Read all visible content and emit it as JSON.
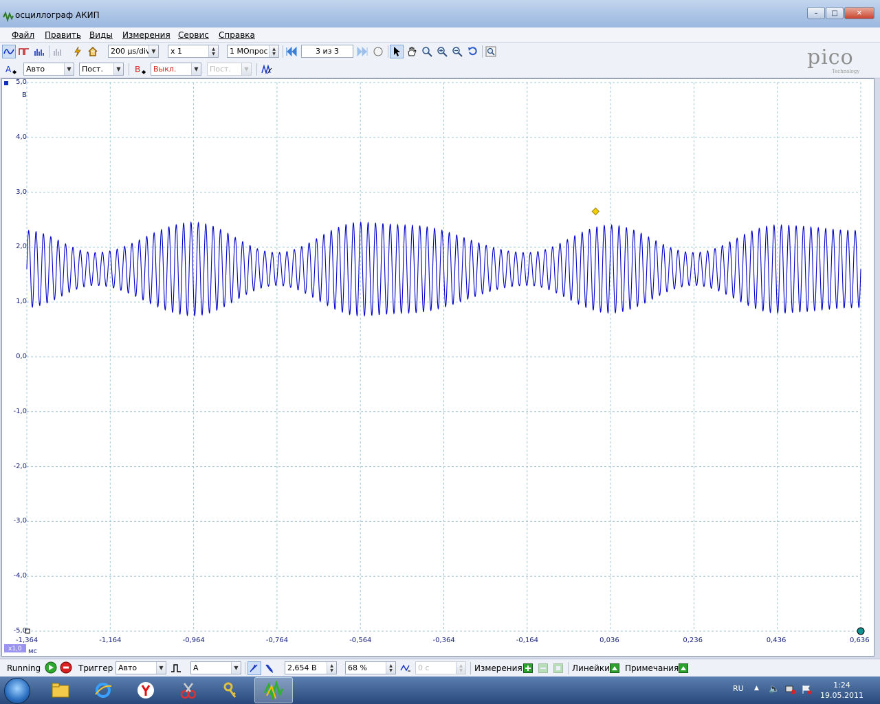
{
  "window": {
    "title": "осциллограф АКИП",
    "minimize": "–",
    "maximize": "□",
    "close": "✕"
  },
  "menu": [
    "Файл",
    "Править",
    "Виды",
    "Измерения",
    "Сервис",
    "Справка"
  ],
  "toolbar1": {
    "timebase": "200 µs/div",
    "zoom": "x 1",
    "samples": "1 МОпрос",
    "buffer": "3 из 3"
  },
  "toolbar2": {
    "chA_label": "A",
    "chA_range": "Авто",
    "chA_coupling": "Пост.",
    "chB_label": "B",
    "chB_range": "Выкл.",
    "chB_coupling": "Пост."
  },
  "logo": {
    "word": "pico",
    "sub": "Technology"
  },
  "plot": {
    "y_labels": [
      "5,0",
      "4,0",
      "3,0",
      "2,0",
      "1,0",
      "0,0",
      "-1,0",
      "-2,0",
      "-3,0",
      "-4,0",
      "-5,0"
    ],
    "y_unit": "В",
    "x_labels": [
      "-1,364",
      "-1,164",
      "-0,964",
      "-0,764",
      "-0,564",
      "-0,364",
      "-0,164",
      "0,036",
      "0,236",
      "0,436",
      "0,636"
    ],
    "x_unit": "мс",
    "zoom_badge": "x1,0",
    "trace_color": "#0000c8",
    "grid_color": "#9fc7d3"
  },
  "chart_data": {
    "type": "line",
    "xlabel": "мс",
    "ylabel": "В",
    "xlim": [
      -1.364,
      0.636
    ],
    "ylim": [
      -5.0,
      5.0
    ],
    "grid": true,
    "series": [
      {
        "carrier_cycles": 113,
        "mean_volts": 1.6,
        "envelope_ms": [
          -1.364,
          -1.2,
          -0.964,
          -0.764,
          -0.564,
          -0.45,
          -0.164,
          0.036,
          0.236,
          0.436,
          0.636
        ],
        "envelope_amp_volts": [
          0.7,
          0.3,
          0.85,
          0.3,
          0.85,
          0.8,
          0.3,
          0.8,
          0.3,
          0.8,
          0.7
        ]
      }
    ],
    "trigger_marker": {
      "x": -0.0,
      "y": 2.65
    }
  },
  "status": {
    "running": "Running",
    "trigger_label": "Триггер",
    "trigger_mode": "Авто",
    "trigger_source": "A",
    "trigger_level": "2,654 В",
    "pretrigger": "68 %",
    "delay": "0 с",
    "measurements": "Измерения",
    "rulers": "Линейки",
    "notes": "Примечания"
  },
  "taskbar": {
    "lang": "RU",
    "time": "1:24",
    "date": "19.05.2011"
  }
}
